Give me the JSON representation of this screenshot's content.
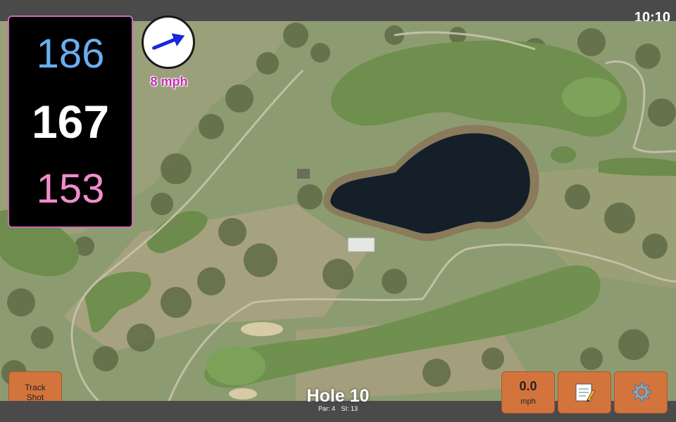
{
  "status_bar": {
    "time": "10:10"
  },
  "distances": {
    "back": "186",
    "middle": "167",
    "front": "153",
    "colors": {
      "back": "#6aaef0",
      "middle": "#ffffff",
      "front": "#f28ccc"
    }
  },
  "wind": {
    "speed_label": "8 mph",
    "arrow_color": "#1a28d8",
    "text_color": "#c22fb4"
  },
  "track_shot": {
    "label": "Track\nShot"
  },
  "hole": {
    "title": "Hole 10",
    "par_label": "Par: 4",
    "si_label": "SI: 13"
  },
  "wind_speed_button": {
    "value": "0.0",
    "unit": "mph"
  },
  "icons": {
    "map": "satellite-map",
    "notes": "notepad-icon",
    "settings": "gear-icon",
    "wind": "wind-arrow-icon"
  },
  "colors": {
    "button": "#d4743d",
    "bar": "#4a4a4a",
    "panel": "#000000"
  }
}
